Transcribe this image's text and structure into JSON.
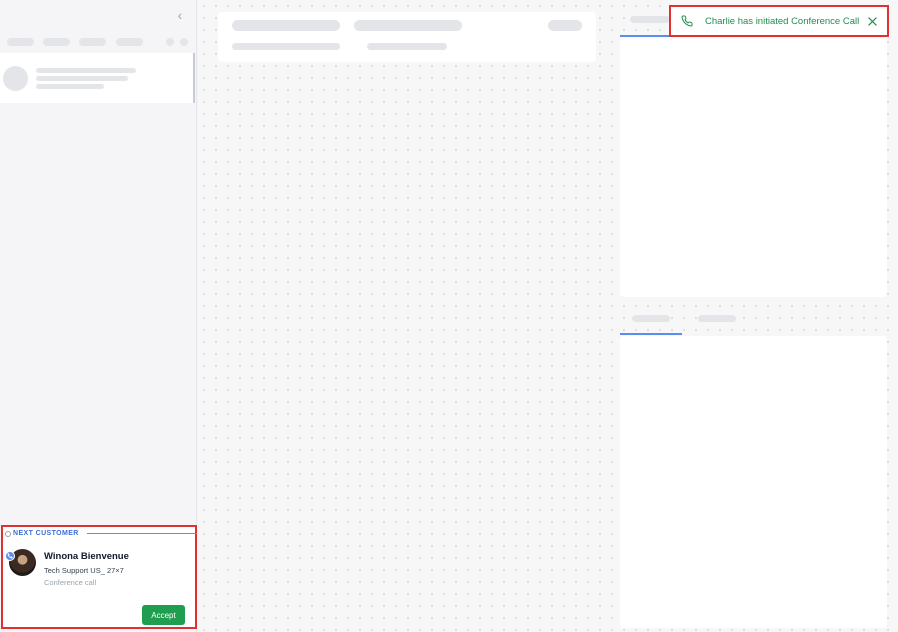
{
  "notification": {
    "message": "Charlie has initiated Conference Call",
    "icon": "phone-icon",
    "close_icon": "close-icon",
    "color": "#1e8e4e"
  },
  "sidebar": {
    "collapse_icon": "chevron-left-icon",
    "collapse_glyph": "‹"
  },
  "next_customer": {
    "label": "NEXT CUSTOMER",
    "name": "Winona Bienvenue",
    "queue": "Tech Support US_ 27×7",
    "type": "Conference call",
    "accept_label": "Accept",
    "accent_color": "#1e9e4e"
  }
}
